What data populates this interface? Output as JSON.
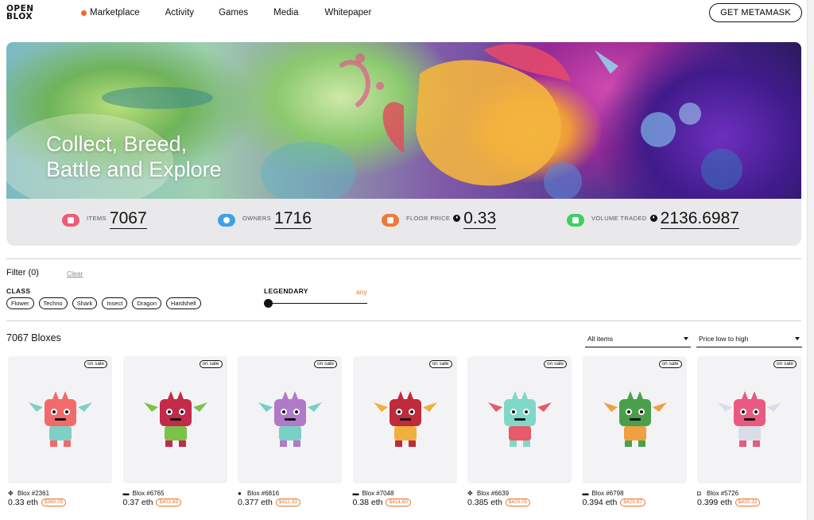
{
  "header": {
    "logo_line1": "OPEN",
    "logo_line2": "BLOX",
    "nav": [
      {
        "label": "Marketplace",
        "active": true
      },
      {
        "label": "Activity"
      },
      {
        "label": "Games"
      },
      {
        "label": "Media"
      },
      {
        "label": "Whitepaper"
      }
    ],
    "cta": "GET METAMASK"
  },
  "hero": {
    "title_line1": "Collect, Breed,",
    "title_line2": "Battle and Explore"
  },
  "stats": [
    {
      "label": "ITEMS",
      "value": "7067",
      "icon": "items-icon",
      "color": "#ef5a74"
    },
    {
      "label": "OWNERS",
      "value": "1716",
      "icon": "owners-icon",
      "color": "#3fa1e6"
    },
    {
      "label": "FLOOR PRICE",
      "value": "0.33",
      "icon": "floor-price-icon",
      "color": "#f07a3a"
    },
    {
      "label": "VOLUME TRADED",
      "value": "2136.6987",
      "icon": "volume-icon",
      "color": "#3fcf62"
    }
  ],
  "filter": {
    "title": "Filter (0)",
    "clear": "Clear",
    "class_label": "CLASS",
    "classes": [
      "Flower",
      "Techno",
      "Shark",
      "Insect",
      "Dragon",
      "Hardshell"
    ],
    "legendary_label": "LEGENDARY",
    "legendary_value": "any"
  },
  "listing": {
    "count": "7067 Bloxes",
    "items_select": "All items",
    "sort_select": "Price low to high"
  },
  "accent_color": "#e9752b",
  "cards": [
    {
      "name": "Blox #2361",
      "eth": "0.33 eth",
      "usd": "$360.05",
      "badge": "on sale",
      "class_icon": "dragon-icon",
      "glyph": "✥",
      "body": "#f26b6b",
      "accent": "#7fd0c4"
    },
    {
      "name": "Blox #6765",
      "eth": "0.37 eth",
      "usd": "$403.69",
      "badge": "on sale",
      "class_icon": "shark-icon",
      "glyph": "▬",
      "body": "#c42a4a",
      "accent": "#7bc24a"
    },
    {
      "name": "Blox #6816",
      "eth": "0.377 eth",
      "usd": "$411.33",
      "badge": "on sale",
      "class_icon": "insect-icon",
      "glyph": "●",
      "body": "#b07ac8",
      "accent": "#78d0c4"
    },
    {
      "name": "Blox #7048",
      "eth": "0.38 eth",
      "usd": "$414.60",
      "badge": "on sale",
      "class_icon": "shark-icon",
      "glyph": "▬",
      "body": "#c02a3a",
      "accent": "#f0b040"
    },
    {
      "name": "Blox #6639",
      "eth": "0.385 eth",
      "usd": "$420.05",
      "badge": "on sale",
      "class_icon": "dragon-icon",
      "glyph": "✥",
      "body": "#7fd8c8",
      "accent": "#e85a6a"
    },
    {
      "name": "Blox #6798",
      "eth": "0.394 eth",
      "usd": "$429.87",
      "badge": "on sale",
      "class_icon": "shark-icon",
      "glyph": "▬",
      "body": "#4aa04a",
      "accent": "#f0a040"
    },
    {
      "name": "Blox #5726",
      "eth": "0.399 eth",
      "usd": "$435.33",
      "badge": "on sale",
      "class_icon": "techno-icon",
      "glyph": "◘",
      "body": "#e85a80",
      "accent": "#d8dde8"
    }
  ]
}
